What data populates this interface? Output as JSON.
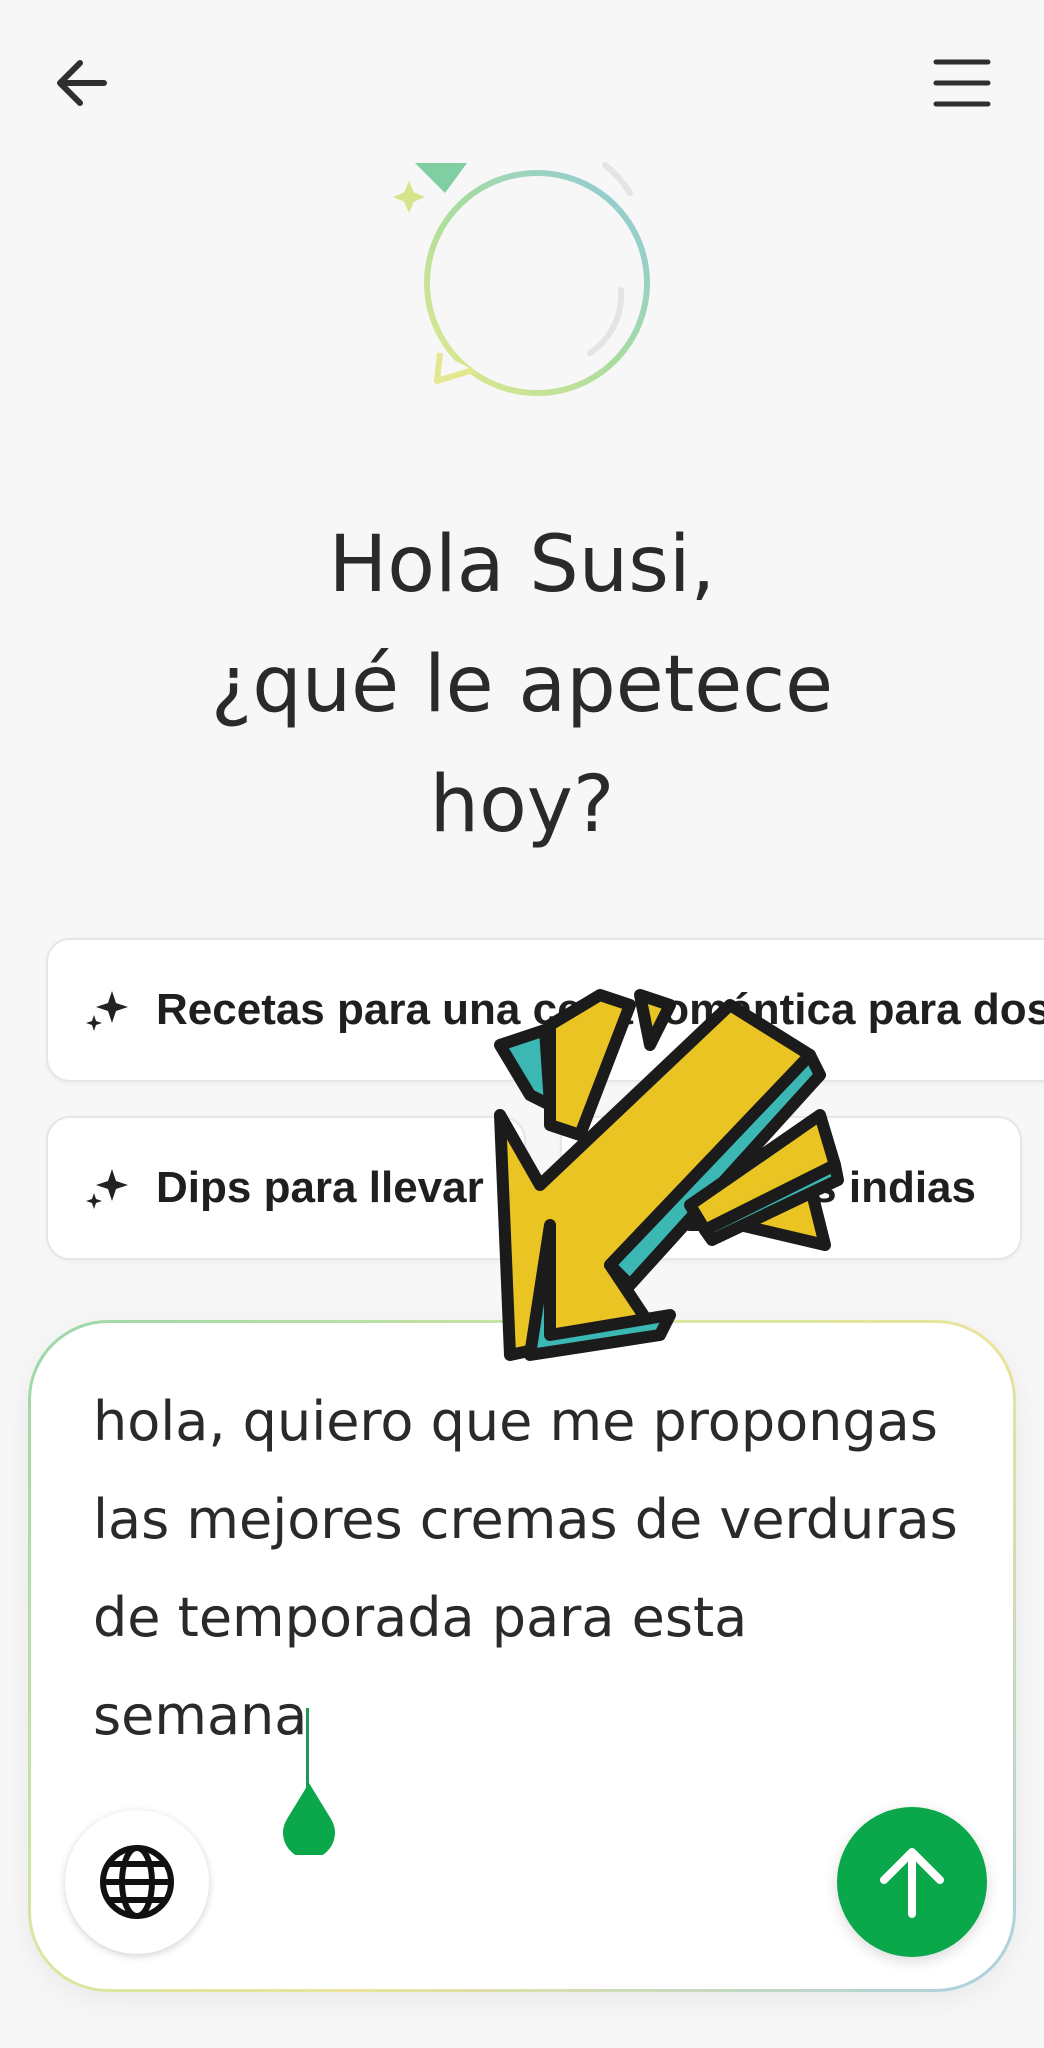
{
  "header": {
    "back_icon": "arrow-left-icon",
    "menu_icon": "hamburger-menu-icon"
  },
  "hero": {
    "icon": "chat-bubble-sparkle-icon"
  },
  "greeting": {
    "line1": "Hola Susi,",
    "line2": "¿qué le apetece",
    "line3": "hoy?"
  },
  "suggestions": [
    {
      "icon": "sparkle-icon",
      "label": "Recetas para una cena romántica para dos"
    },
    {
      "icon": "sparkle-icon",
      "label": "Dips para llevar"
    },
    {
      "icon": "sparkle-icon",
      "label": "Recetas indias"
    }
  ],
  "composer": {
    "lines": [
      "hola, quiero que me propongas",
      "las mejores cremas de verduras",
      "de temporada para esta",
      "semana"
    ],
    "language_icon": "globe-icon",
    "send_icon": "arrow-up-icon"
  },
  "colors": {
    "accent_green": "#0aa84a",
    "background": "#f7f7f8",
    "overlay_yellow": "#e9c423",
    "overlay_teal": "#3bb8b3"
  }
}
